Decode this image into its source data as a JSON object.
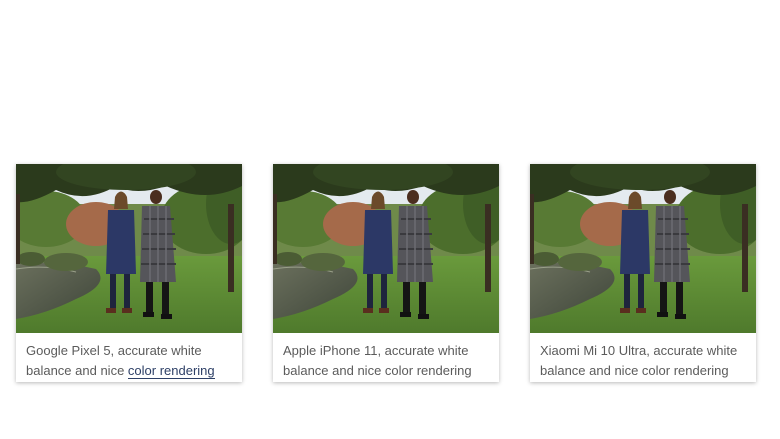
{
  "gallery": {
    "cards": [
      {
        "caption_text": "Google Pixel 5, accurate white balance and nice ",
        "caption_link": "color rendering",
        "photo_icon": "photo-two-women-in-park"
      },
      {
        "caption_text": "Apple iPhone 11, accurate white balance and nice color rendering",
        "photo_icon": "photo-two-women-in-park"
      },
      {
        "caption_text": "Xiaomi Mi 10 Ultra, accurate white balance and nice color rendering",
        "photo_icon": "photo-two-women-in-park"
      }
    ]
  },
  "colors": {
    "caption_text": "#5b5b5b",
    "link": "#2d3f66",
    "grass": "#5c8a35",
    "sky": "#e4eaef"
  }
}
